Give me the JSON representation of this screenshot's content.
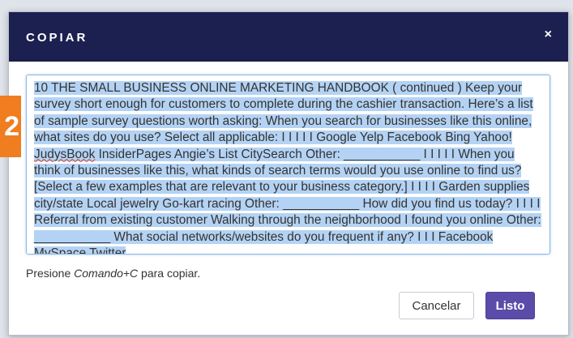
{
  "step_badge": "2",
  "dialog": {
    "title": "COPIAR",
    "close_symbol": "×",
    "textarea_value_part1": "10 THE SMALL BUSINESS ONLINE MARKETING HANDBOOK ( continued ) Keep your survey short enough for customers to complete during the cashier transaction. Here’s a list of sample survey questions worth asking: When you search for businesses like this online, what sites do you use? Select all applicable: I I I I I Google Yelp Facebook Bing Yahoo! ",
    "textarea_value_misspelled": "JudysBook",
    "textarea_value_part2": " InsiderPages Angie’s List CitySearch Other: ___________ I I I I I When you think of businesses like this, what kinds of search terms would you use online to find us? [Select a few examples that are relevant to your business category.] I I I I Garden supplies city/state Local jewelry Go-kart racing Other: ___________ How did you find us today? I I I I Referral from existing customer Walking through the neighborhood I found you online Other: ___________ What social networks/websites do you frequent if any? I I I Facebook MySpace Twitter",
    "hint_prefix": "Presione ",
    "hint_shortcut": "Comando+C",
    "hint_suffix": " para copiar.",
    "cancel_label": "Cancelar",
    "ok_label": "Listo"
  },
  "colors": {
    "header_bg": "#1c2050",
    "selection": "#b4d3f4",
    "primary_button": "#5a4ca8",
    "badge": "#f07d1f"
  }
}
